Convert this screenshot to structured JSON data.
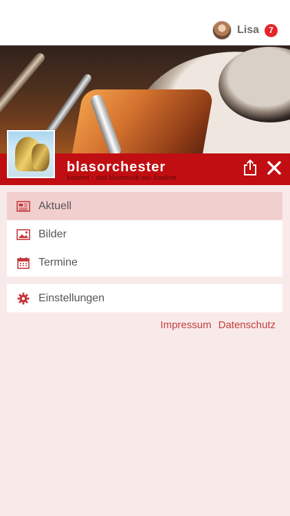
{
  "user": {
    "name": "Lisa",
    "notification_count": "7"
  },
  "header": {
    "brand_title": "blasorchester",
    "brand_subtitle": "konzert - und blasmusik aus franken"
  },
  "menu": {
    "items": [
      {
        "label": "Aktuell",
        "icon": "newspaper-icon",
        "active": true
      },
      {
        "label": "Bilder",
        "icon": "image-icon",
        "active": false
      },
      {
        "label": "Termine",
        "icon": "calendar-icon",
        "active": false
      }
    ],
    "settings": {
      "label": "Einstellungen",
      "icon": "gear-icon"
    }
  },
  "footer": {
    "impressum": "Impressum",
    "datenschutz": "Datenschutz"
  },
  "colors": {
    "accent_red": "#c10e12",
    "icon_red": "#c4373a",
    "background": "#f9eaea",
    "active_row": "#f2cfcf"
  }
}
